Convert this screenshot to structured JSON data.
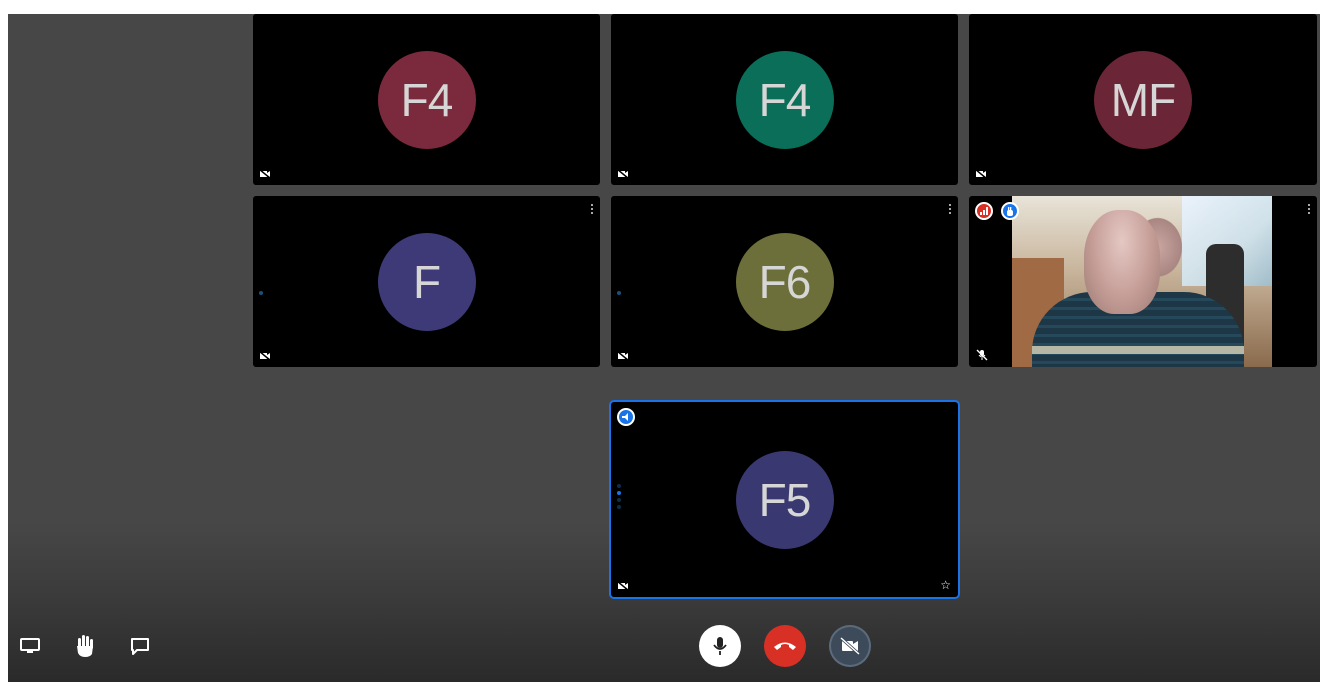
{
  "colors": {
    "stage_bg": "#474747",
    "tile_bg": "#000000",
    "active_border": "#1a73e8",
    "end_call_red": "#d93025",
    "mic_button_bg": "#ffffff",
    "camera_button_bg": "#3c4a59"
  },
  "participants": [
    {
      "initials": "F4",
      "avatar_color": "#7a2a3c",
      "camera": "off",
      "icon": "camera-off-icon"
    },
    {
      "initials": "F4",
      "avatar_color": "#0b6e58",
      "camera": "off",
      "icon": "camera-off-icon"
    },
    {
      "initials": "MF",
      "avatar_color": "#6a2536",
      "camera": "off",
      "icon": "camera-off-icon"
    },
    {
      "initials": "F",
      "avatar_color": "#3d3a77",
      "camera": "off",
      "icon": "camera-off-icon"
    },
    {
      "initials": "F6",
      "avatar_color": "#6d6f3a",
      "camera": "off",
      "icon": "camera-off-icon"
    },
    {
      "initials": "",
      "camera": "on",
      "icons": [
        "connection-quality-icon",
        "raised-hand-icon",
        "mic-off-icon"
      ]
    },
    {
      "initials": "F5",
      "avatar_color": "#3a3870",
      "camera": "off",
      "dominant_speaker": true,
      "icons": [
        "speaking-badge-icon",
        "camera-off-icon",
        "star-icon"
      ]
    }
  ],
  "toolbar": {
    "left_buttons": [
      "screen-share-icon",
      "raise-hand-icon",
      "chat-icon"
    ],
    "center_buttons": [
      "microphone-icon",
      "hang-up-icon",
      "camera-off-icon"
    ]
  }
}
